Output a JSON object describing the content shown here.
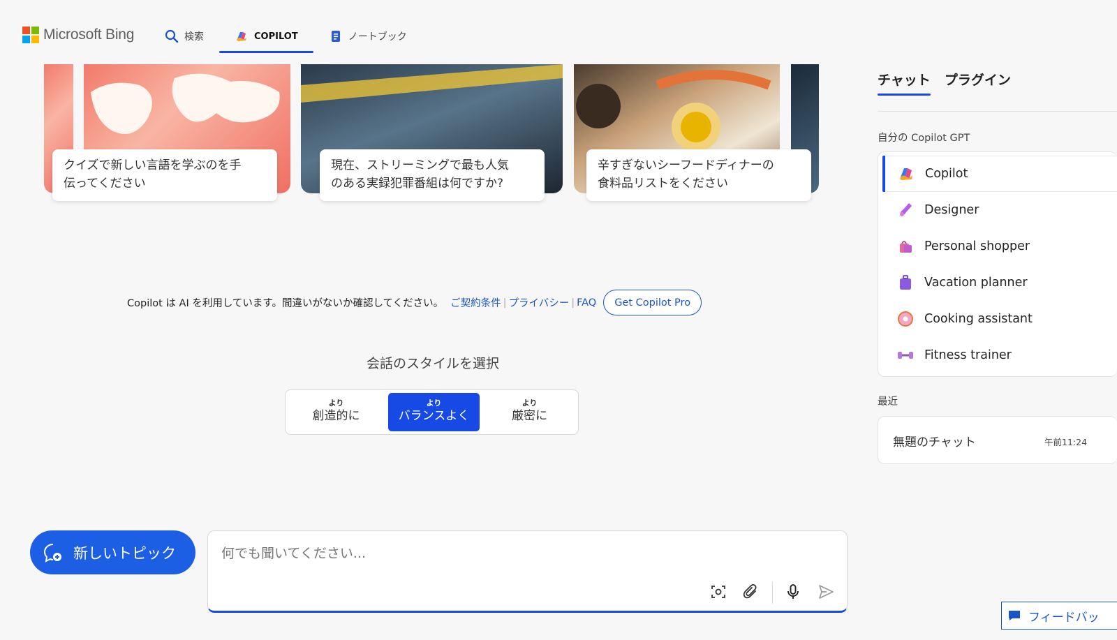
{
  "header": {
    "brand": "Microsoft Bing",
    "nav": [
      {
        "label": "検索",
        "icon": "search-icon"
      },
      {
        "label": "COPILOT",
        "icon": "copilot-icon"
      },
      {
        "label": "ノートブック",
        "icon": "notebook-icon"
      }
    ],
    "active_nav": "COPILOT"
  },
  "suggestions": [
    {
      "text_line1": "クイズで新しい言語を学ぶのを手",
      "text_line2": "伝ってください"
    },
    {
      "text_line1": "現在、ストリーミングで最も人気",
      "text_line2": "のある実録犯罪番組は何ですか?"
    },
    {
      "text_line1": "辛すぎないシーフードディナーの",
      "text_line2": "食料品リストをください"
    }
  ],
  "disclaimer": {
    "text": "Copilot は AI を利用しています。間違いがないか確認してください。",
    "links": [
      "ご契約条件",
      "プライバシー",
      "FAQ"
    ],
    "pro_button": "Get Copilot Pro"
  },
  "style_selector": {
    "title": "会話のスタイルを選択",
    "options": [
      {
        "small": "より",
        "big": "創造的に"
      },
      {
        "small": "より",
        "big": "バランスよく"
      },
      {
        "small": "より",
        "big": "厳密に"
      }
    ],
    "selected": "バランスよく"
  },
  "bottom": {
    "new_topic_label": "新しいトピック",
    "input_placeholder": "何でも聞いてください..."
  },
  "sidebar": {
    "tabs": [
      "チャット",
      "プラグイン"
    ],
    "active_tab": "チャット",
    "gpt_section_label": "自分の Copilot GPT",
    "gpts": [
      {
        "label": "Copilot",
        "icon": "copilot-icon"
      },
      {
        "label": "Designer",
        "icon": "designer-icon"
      },
      {
        "label": "Personal shopper",
        "icon": "shopping-bag-icon"
      },
      {
        "label": "Vacation planner",
        "icon": "suitcase-icon"
      },
      {
        "label": "Cooking assistant",
        "icon": "donut-icon"
      },
      {
        "label": "Fitness trainer",
        "icon": "dumbbell-icon"
      }
    ],
    "recent_label": "最近",
    "recent": [
      {
        "title": "無題のチャット",
        "time": "午前11:24"
      }
    ]
  },
  "feedback_label": "フィードバッ",
  "colors": {
    "accent": "#174ae4",
    "link": "#1a55c8",
    "new_topic_bg": "#1c5ee4"
  }
}
